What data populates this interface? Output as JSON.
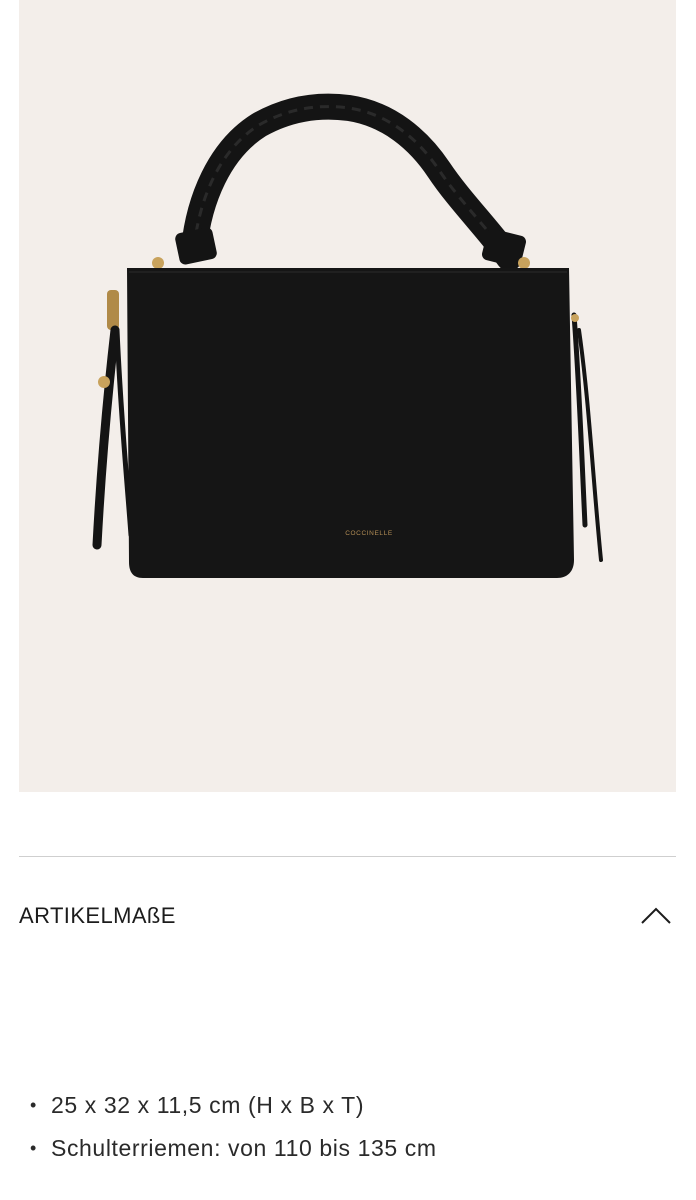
{
  "product_image": {
    "icon": "handbag-photo",
    "brand_logo": "COCCINELLE",
    "bag_color": "#151515",
    "background_color": "#f3eeea",
    "hardware_color": "#c8a25c"
  },
  "accordion": {
    "title": "ARTIKELMAßE",
    "expanded": true,
    "toggle_icon": "chevron-up-icon"
  },
  "details": {
    "items": [
      {
        "text": "25 x 32 x 11,5 cm (H x B x T)"
      },
      {
        "text": "Schulterriemen: von 110 bis 135 cm"
      }
    ]
  }
}
